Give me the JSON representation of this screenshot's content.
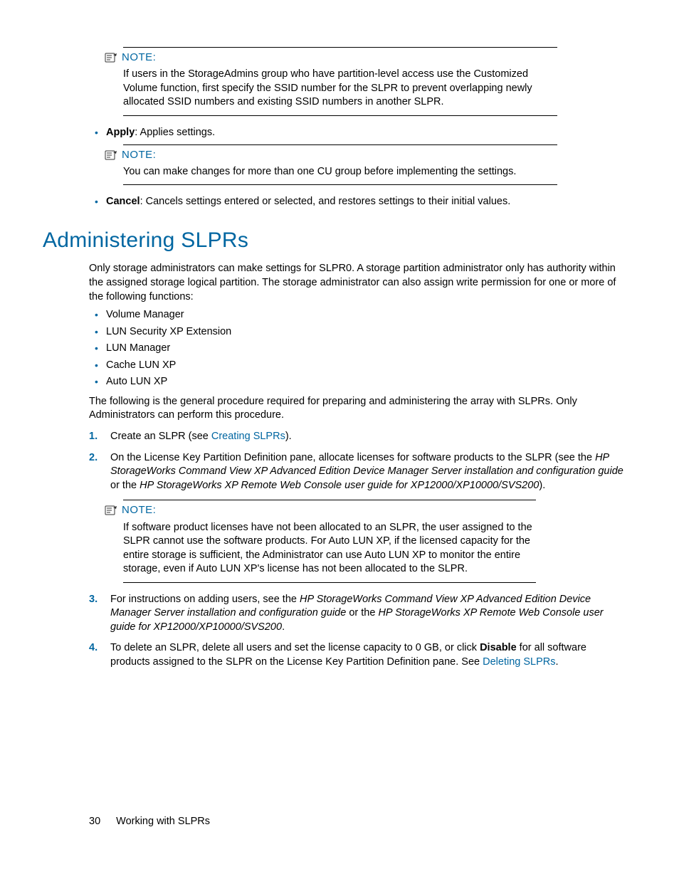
{
  "notes": {
    "note1_label": "NOTE:",
    "note1_body": "If users in the StorageAdmins group who have partition-level access use the Customized Volume function, first specify the SSID number for the SLPR to prevent overlapping newly allocated SSID numbers and existing SSID numbers in another SLPR.",
    "note2_label": "NOTE:",
    "note2_body": "You can make changes for more than one CU group before implementing the settings.",
    "note3_label": "NOTE:",
    "note3_body": "If software product licenses have not been allocated to an SLPR, the user assigned to the SLPR cannot use the software products. For Auto LUN XP, if the licensed capacity for the entire storage is sufficient, the Administrator can use Auto LUN XP to monitor the entire storage, even if Auto LUN XP's license has not been allocated to the SLPR."
  },
  "bullets_top": {
    "apply_bold": "Apply",
    "apply_rest": ": Applies settings.",
    "cancel_bold": "Cancel",
    "cancel_rest": ": Cancels settings entered or selected, and restores settings to their initial values."
  },
  "heading": "Administering SLPRs",
  "intro_para": "Only storage administrators can make settings for SLPR0. A storage partition administrator only has authority within the assigned storage logical partition. The storage administrator can also assign write permission for one or more of the following functions:",
  "func_bullets": [
    "Volume Manager",
    "LUN Security XP Extension",
    "LUN Manager",
    "Cache LUN XP",
    "Auto LUN XP"
  ],
  "para2": "The following is the general procedure required for preparing and administering the array with SLPRs. Only Administrators can perform this procedure.",
  "steps": {
    "s1_a": "Create an SLPR (see ",
    "s1_link": "Creating SLPRs",
    "s1_b": ").",
    "s2_a": "On the License Key Partition Definition pane, allocate licenses for software products to the SLPR (see the ",
    "s2_it1": "HP StorageWorks Command View XP Advanced Edition Device Manager Server installation and configuration guide",
    "s2_mid": " or the ",
    "s2_it2": "HP StorageWorks XP Remote Web Console user guide for XP12000/XP10000/SVS200",
    "s2_b": ").",
    "s3_a": "For instructions on adding users, see the ",
    "s3_it1": "HP StorageWorks Command View XP Advanced Edition Device Manager Server installation and configuration guide",
    "s3_mid": " or the ",
    "s3_it2": "HP StorageWorks XP Remote Web Console user guide for XP12000/XP10000/SVS200",
    "s3_b": ".",
    "s4_a": "To delete an SLPR, delete all users and set the license capacity to 0 GB, or click ",
    "s4_bold": "Disable",
    "s4_b": " for all software products assigned to the SLPR on the License Key Partition Definition pane. See ",
    "s4_link": "Deleting SLPRs",
    "s4_c": "."
  },
  "footer": {
    "page_num": "30",
    "section": "Working with SLPRs"
  }
}
